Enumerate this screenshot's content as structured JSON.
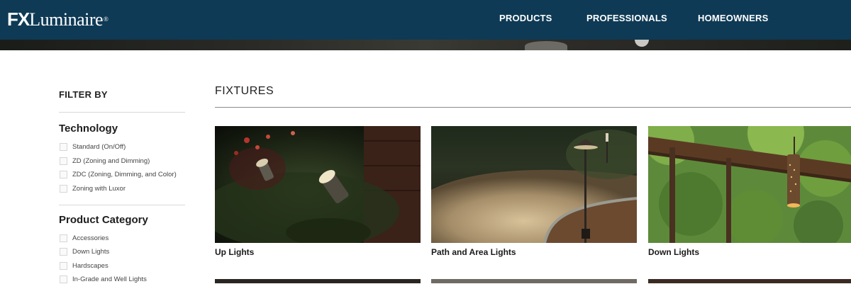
{
  "brand": {
    "fx": "FX",
    "name": "Luminaire",
    "reg": "®"
  },
  "nav": [
    {
      "label": "PRODUCTS"
    },
    {
      "label": "PROFESSIONALS"
    },
    {
      "label": "HOMEOWNERS"
    }
  ],
  "filter": {
    "title": "FILTER BY",
    "groups": [
      {
        "title": "Technology",
        "options": [
          "Standard (On/Off)",
          "ZD (Zoning and Dimming)",
          "ZDC (Zoning, Dimming, and Color)",
          "Zoning with Luxor"
        ]
      },
      {
        "title": "Product Category",
        "options": [
          "Accessories",
          "Down Lights",
          "Hardscapes",
          "In-Grade and Well Lights"
        ]
      }
    ]
  },
  "main": {
    "title": "FIXTURES",
    "cards": [
      {
        "label": "Up Lights"
      },
      {
        "label": "Path and Area Lights"
      },
      {
        "label": "Down Lights"
      }
    ]
  },
  "colors": {
    "navbar": "#0e3a55",
    "rule": "#8a8a8a"
  }
}
